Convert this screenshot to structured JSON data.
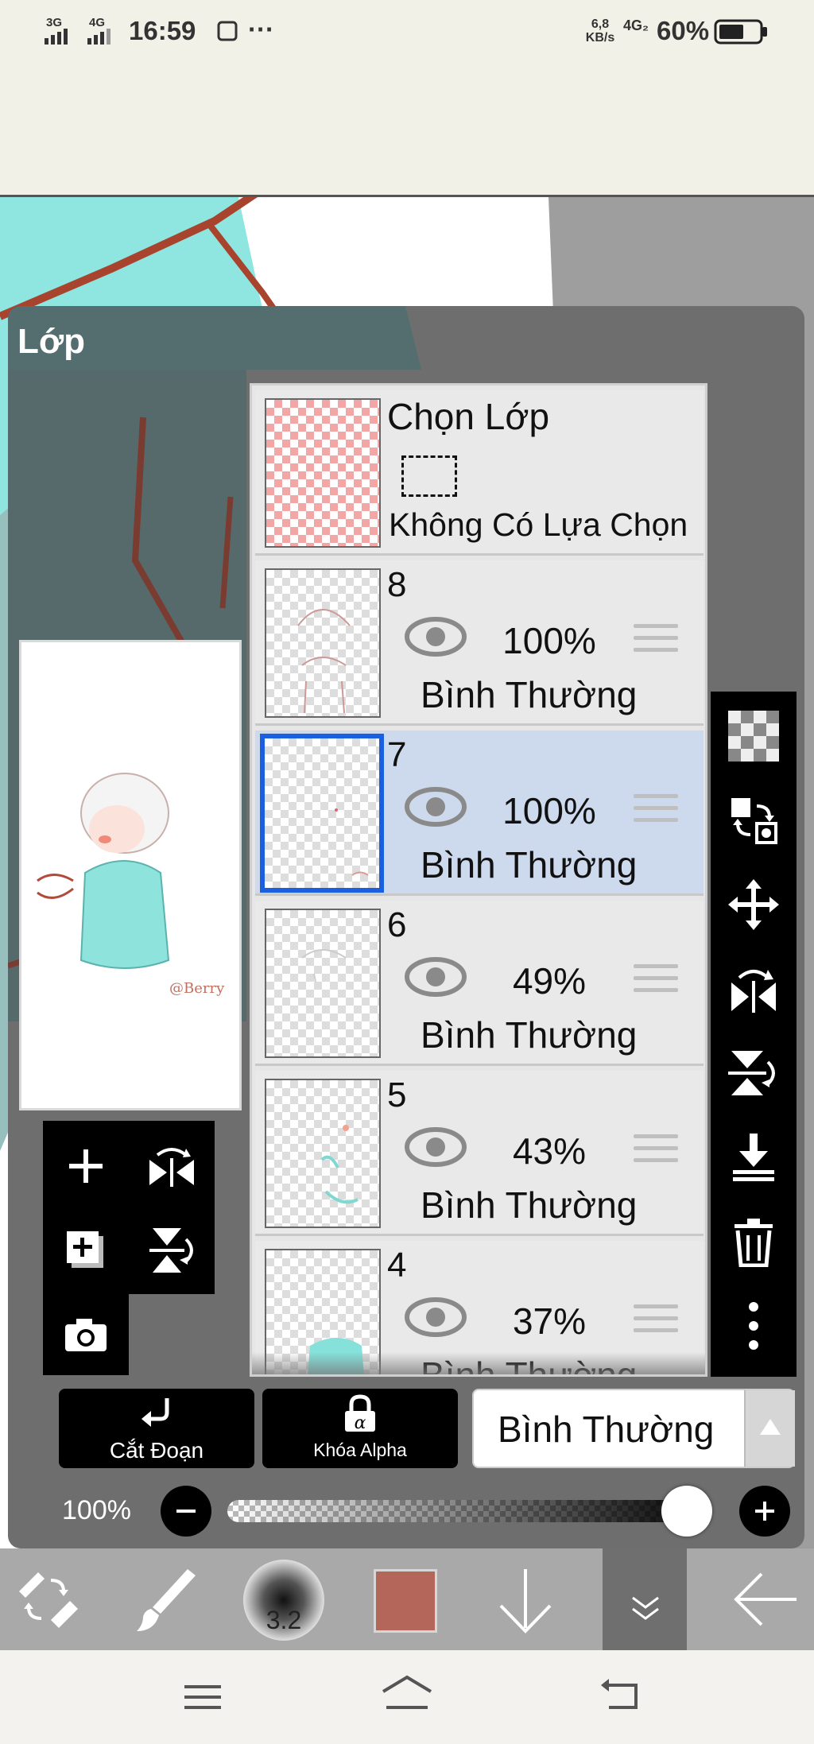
{
  "status_bar": {
    "signal_1": "3G",
    "signal_2": "4G",
    "time": "16:59",
    "more": "···",
    "net_speed_value": "6,8",
    "net_speed_unit": "KB/s",
    "net_type": "4G₂",
    "battery": "60%"
  },
  "panel": {
    "title": "Lớp",
    "preview_watermark": "@Berry"
  },
  "layers": [
    {
      "type": "selection",
      "title": "Chọn Lớp",
      "subtitle": "Không Có Lựa Chọn"
    },
    {
      "number": "8",
      "opacity": "100%",
      "blend": "Bình Thường",
      "selected": false
    },
    {
      "number": "7",
      "opacity": "100%",
      "blend": "Bình Thường",
      "selected": true
    },
    {
      "number": "6",
      "opacity": "49%",
      "blend": "Bình Thường",
      "selected": false
    },
    {
      "number": "5",
      "opacity": "43%",
      "blend": "Bình Thường",
      "selected": false
    },
    {
      "number": "4",
      "opacity": "37%",
      "blend": "Bình Thường",
      "selected": false
    }
  ],
  "controls": {
    "clip_label": "Cắt Đoạn",
    "alpha_lock_label": "Khóa Alpha",
    "blend_mode": "Bình Thường",
    "opacity_label": "100%",
    "opacity_value": 1.0
  },
  "app_toolbar": {
    "brush_size": "3.2",
    "current_color": "#b5665a"
  },
  "colors": {
    "accent_selected": "#1a5fe0",
    "selected_row": "#cdd9ec",
    "canvas_teal": "#7fe3df",
    "stroke_brown": "#a8432e"
  }
}
